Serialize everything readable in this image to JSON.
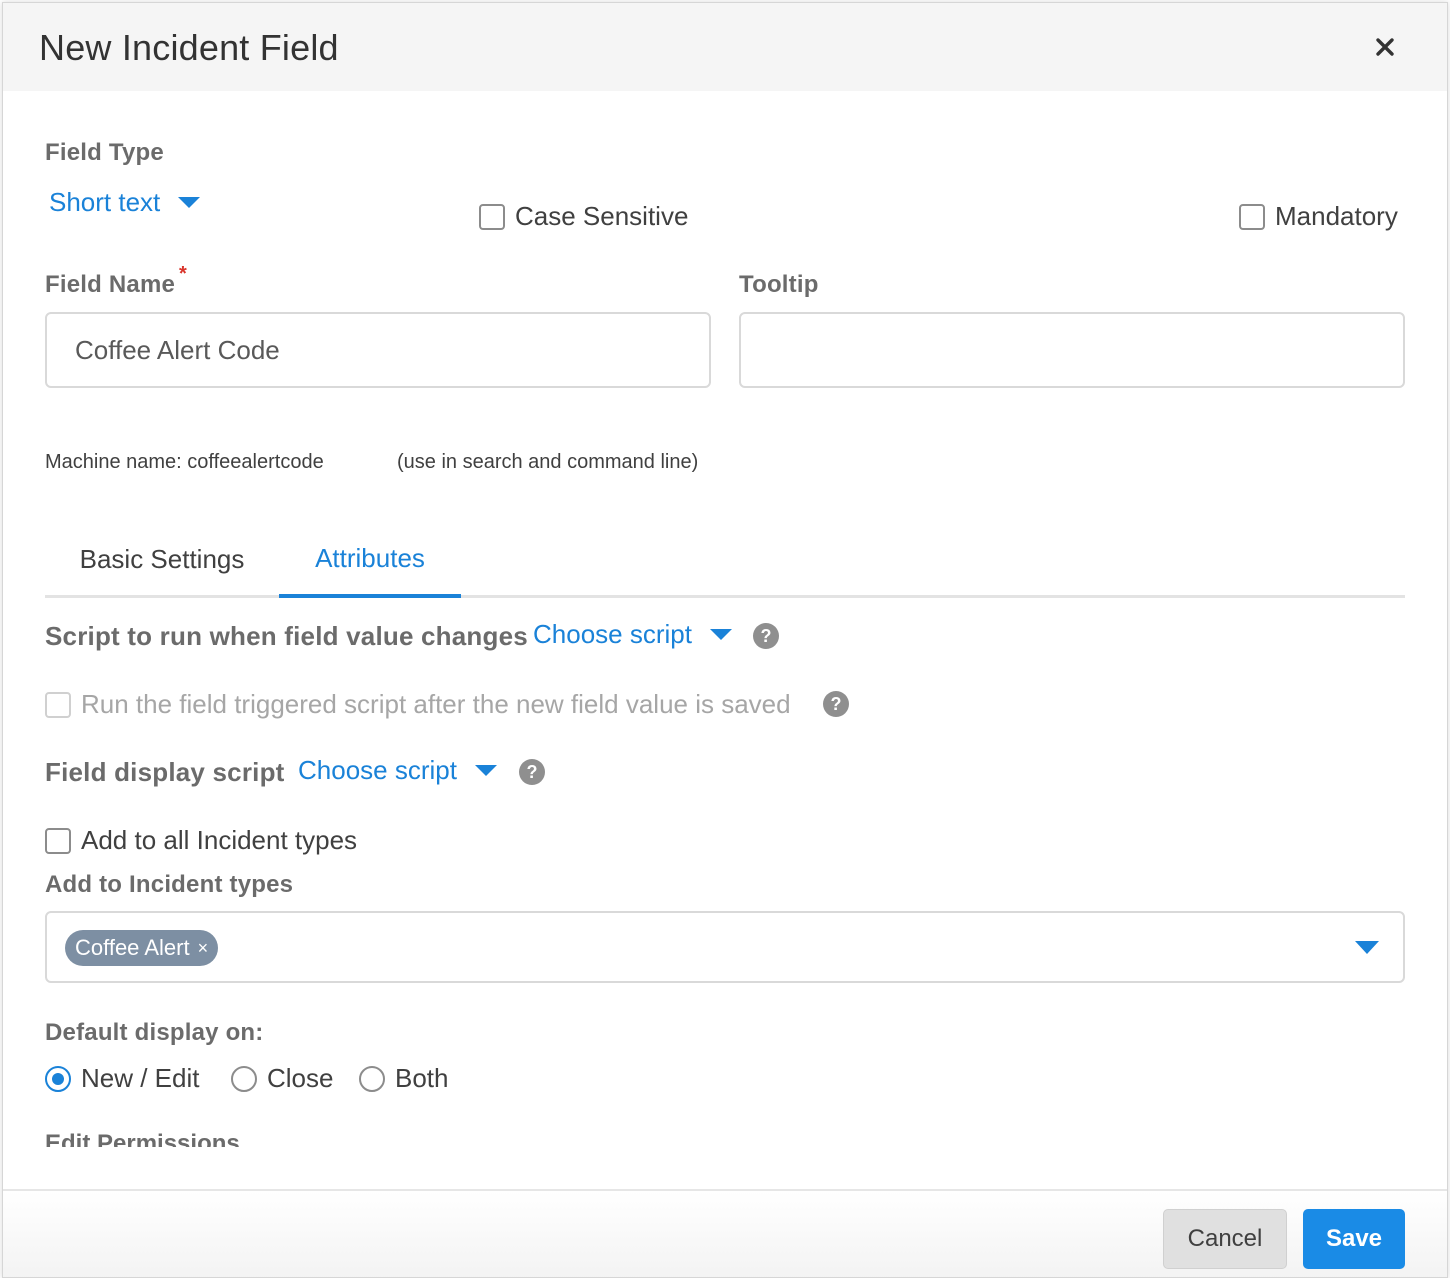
{
  "modal": {
    "title": "New Incident Field",
    "close_label": "×"
  },
  "field_type": {
    "label": "Field Type",
    "value": "Short text"
  },
  "options": {
    "case_sensitive": "Case Sensitive",
    "mandatory": "Mandatory"
  },
  "field_name": {
    "label": "Field Name",
    "required_marker": "*",
    "value": "Coffee Alert Code"
  },
  "tooltip": {
    "label": "Tooltip",
    "value": ""
  },
  "machine_name": {
    "text": "Machine name: coffeealertcode",
    "hint": "(use in search and command line)"
  },
  "tabs": [
    {
      "label": "Basic Settings",
      "active": false
    },
    {
      "label": "Attributes",
      "active": true
    }
  ],
  "attributes": {
    "script_label": "Script to run when field value changes",
    "script_choose": "Choose script",
    "run_after_save": "Run the field triggered script after the new field value is saved",
    "display_script_label": "Field display script",
    "display_script_choose": "Choose script",
    "help_glyph": "?",
    "add_all_types": "Add to all Incident types",
    "add_types_label": "Add to Incident types",
    "selected_types": [
      "Coffee Alert"
    ],
    "chip_remove": "×",
    "default_display_label": "Default display on:",
    "display_options": [
      "New / Edit",
      "Close",
      "Both"
    ],
    "display_selected": "New / Edit",
    "edit_permissions_label": "Edit Permissions"
  },
  "footer": {
    "cancel_label": "Cancel",
    "save_label": "Save"
  },
  "colors": {
    "accent": "#1a82d8",
    "save_button": "#1a8be6",
    "chip": "#7d8fa3",
    "required": "#d9342b"
  }
}
